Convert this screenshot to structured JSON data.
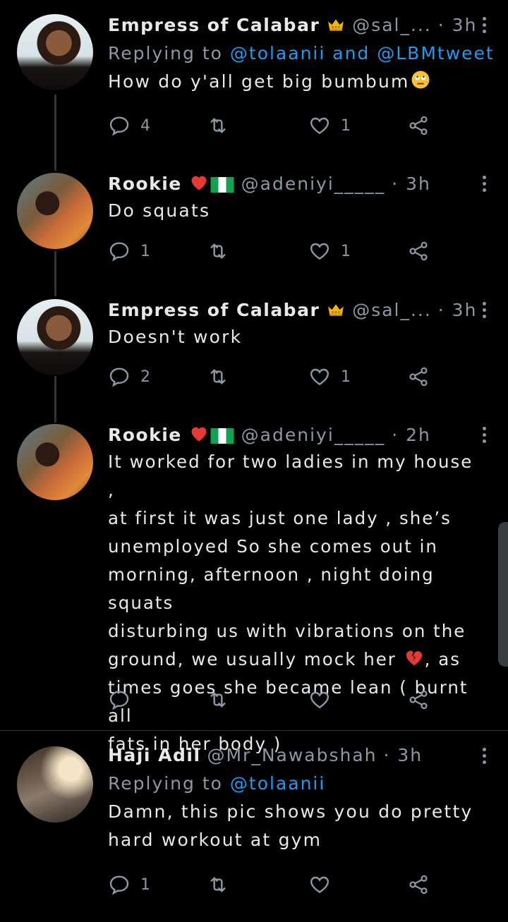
{
  "tweets": [
    {
      "name": "Empress of Calabar",
      "badge": "crown-emoji",
      "handle": "@sal_...",
      "time": "· 3h",
      "replying_prefix": "Replying to",
      "replying_to": "@tolaanii and @LBMtweet",
      "text": "How do y'all get big bumbum",
      "text_emoji": "eye-roll-emoji",
      "replies": "4",
      "retweets": "",
      "likes": "1"
    },
    {
      "name": "Rookie",
      "badge": "heart-nigeria-flag-emoji",
      "handle": "@adeniyi_____",
      "time": "· 3h",
      "text": "Do squats",
      "replies": "1",
      "retweets": "",
      "likes": "1"
    },
    {
      "name": "Empress of Calabar",
      "badge": "crown-emoji",
      "handle": "@sal_...",
      "time": "· 3h",
      "text": "Doesn't work",
      "replies": "2",
      "retweets": "",
      "likes": "1"
    },
    {
      "name": "Rookie",
      "badge": "heart-nigeria-flag-emoji",
      "handle": "@adeniyi_____",
      "time": "· 2h",
      "text_lines": [
        "It worked for two ladies in my house ,",
        "at first it  was just one lady , she’s",
        "unemployed So she comes out in",
        "morning, afternoon , night doing squats",
        "disturbing us with vibrations on the",
        "ground, we usually mock her",
        "times goes she became lean ( burnt all",
        "fats in her body )"
      ],
      "line6_suffix": ", as",
      "replies": "",
      "retweets": "",
      "likes": ""
    },
    {
      "name": "Haji Adil",
      "handle": "@Mr_Nawabshah",
      "time": "· 3h",
      "replying_prefix": "Replying to",
      "replying_to": "@tolaanii",
      "text_lines": [
        "Damn, this pic shows you do pretty",
        "hard workout at gym"
      ],
      "replies": "1",
      "retweets": "",
      "likes": ""
    }
  ],
  "colors": {
    "background": "#000000",
    "text": "#e7e9ea",
    "muted": "#8b98a5",
    "link": "#1d9bf0",
    "line": "#2f3336"
  },
  "icons": [
    "reply-icon",
    "retweet-icon",
    "like-icon",
    "share-icon",
    "more-icon"
  ]
}
